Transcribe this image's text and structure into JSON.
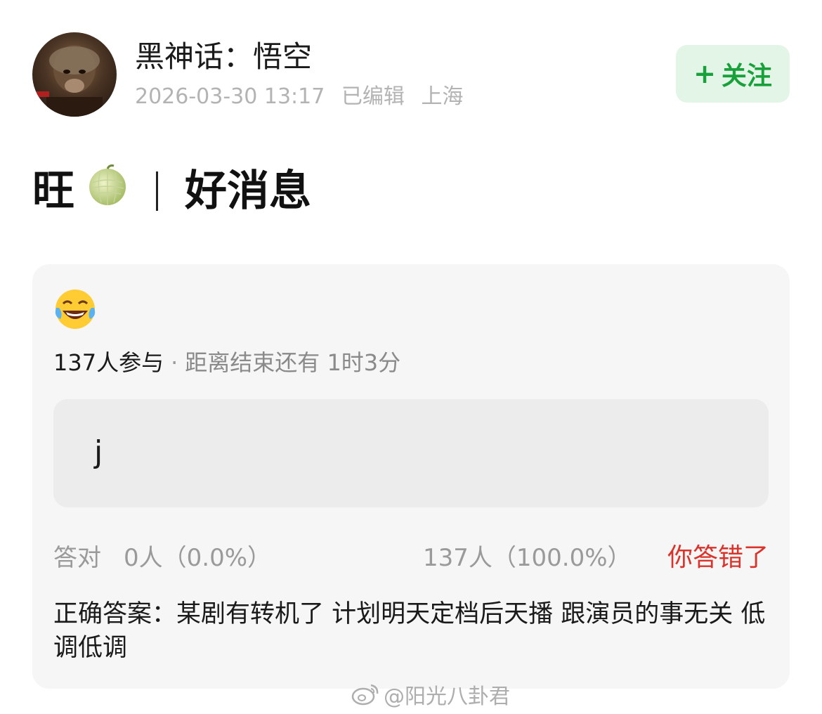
{
  "author": {
    "name": "黑神话：悟空",
    "timestamp": "2026-03-30 13:17",
    "edited": "已编辑",
    "location": "上海"
  },
  "follow": {
    "label": "关注",
    "icon": "plus-icon",
    "color": "#18a03a"
  },
  "post": {
    "title_prefix": "旺",
    "title_icon": "melon-emoji",
    "title_main": "好消息"
  },
  "quiz": {
    "emoji": "face-with-tears-of-joy-emoji",
    "participants": "137人参与",
    "remaining": "距离结束还有 1时3分",
    "option_text": "j",
    "correct_label": "答对",
    "correct_count": "0人（0.0%）",
    "wrong_count": "137人（100.0%）",
    "verdict": "你答错了",
    "verdict_color": "#d9342b",
    "answer": "正确答案：某剧有转机了 计划明天定档后天播 跟演员的事无关 低调低调"
  },
  "watermark": {
    "text": "@阳光八卦君",
    "icon": "weibo-logo-icon"
  }
}
